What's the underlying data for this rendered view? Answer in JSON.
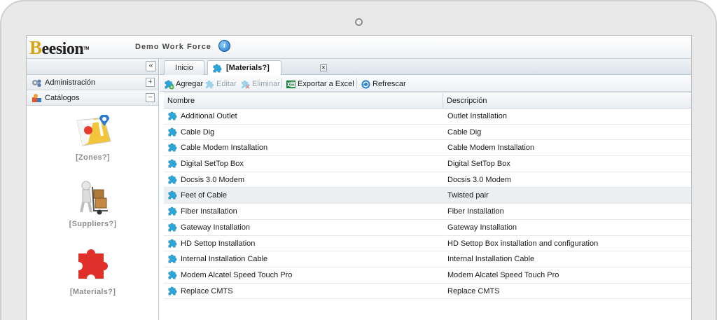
{
  "header": {
    "logo_text": "Beesion",
    "app_title": "Demo Work Force",
    "info_icon": "info-icon"
  },
  "sidebar": {
    "collapse_glyph": "«",
    "sections": [
      {
        "label": "Administración",
        "icon": "gear-users-icon",
        "toggle": "+"
      },
      {
        "label": "Catálogos",
        "icon": "catalog-icon",
        "toggle": "−"
      }
    ],
    "catalog_items": [
      {
        "label": "[Zones?]",
        "icon": "map-pin-icon"
      },
      {
        "label": "[Suppliers?]",
        "icon": "hand-truck-icon"
      },
      {
        "label": "[Materials?]",
        "icon": "puzzle-icon"
      }
    ]
  },
  "tabs": [
    {
      "label": "Inicio",
      "active": false
    },
    {
      "label": "[Materials?]",
      "active": true,
      "close": "×"
    }
  ],
  "toolbar": {
    "add": "Agregar",
    "edit": "Editar",
    "delete": "Eliminar",
    "export": "Exportar a Excel",
    "refresh": "Refrescar"
  },
  "grid": {
    "columns": [
      "Nombre",
      "Descripción"
    ],
    "rows": [
      {
        "name": "Additional Outlet",
        "description": "Outlet Installation"
      },
      {
        "name": "Cable Dig",
        "description": "Cable Dig"
      },
      {
        "name": "Cable Modem Installation",
        "description": "Cable Modem Installation"
      },
      {
        "name": "Digital SetTop Box",
        "description": "Digital SetTop Box"
      },
      {
        "name": "Docsis 3.0 Modem",
        "description": "Docsis 3.0 Modem"
      },
      {
        "name": "Feet of Cable",
        "description": "Twisted pair",
        "selected": true
      },
      {
        "name": "Fiber Installation",
        "description": "Fiber Installation"
      },
      {
        "name": "Gateway Installation",
        "description": "Gateway Installation"
      },
      {
        "name": "HD Settop Installation",
        "description": "HD Settop Box installation and configuration"
      },
      {
        "name": "Internal Installation Cable",
        "description": "Internal Installation Cable"
      },
      {
        "name": "Modem Alcatel Speed Touch Pro",
        "description": "Modem Alcatel Speed Touch Pro"
      },
      {
        "name": "Replace CMTS",
        "description": "Replace CMTS"
      }
    ]
  },
  "colors": {
    "puzzle_blue": "#2aa6d8",
    "puzzle_red": "#e0302a",
    "logo_gold": "#d7a516"
  }
}
